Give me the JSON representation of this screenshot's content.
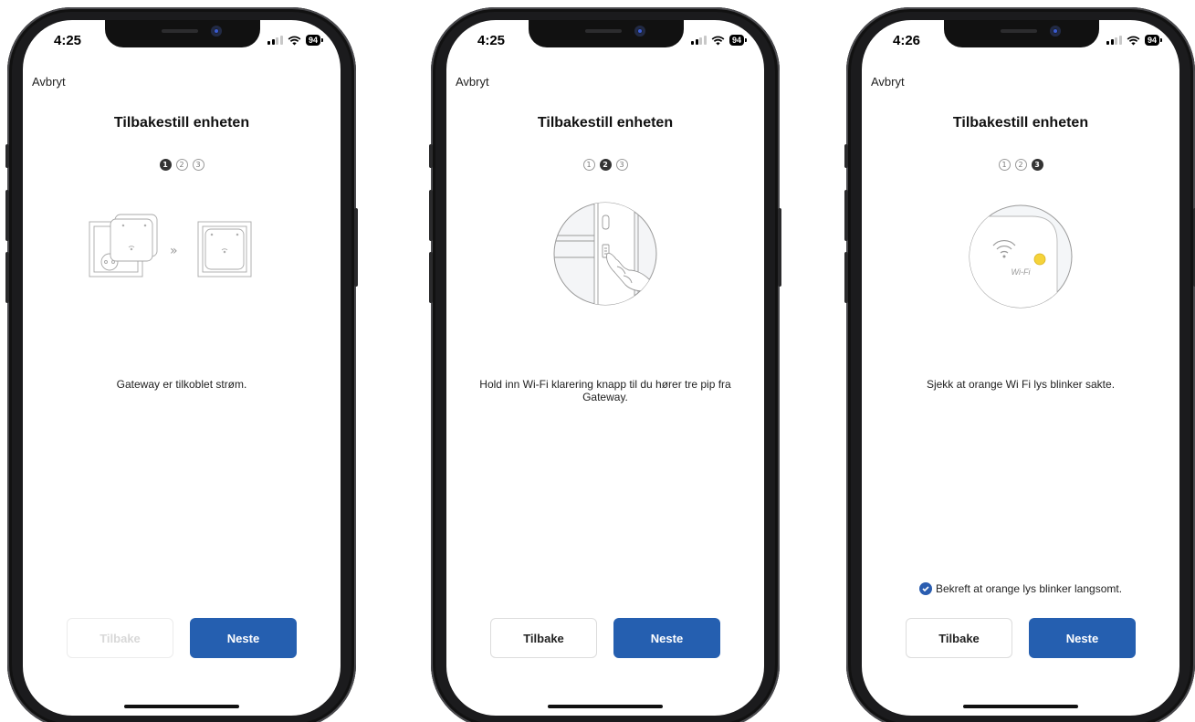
{
  "colors": {
    "accent": "#255fb0",
    "indicator_yellow": "#f5d33a"
  },
  "screens": [
    {
      "time": "4:25",
      "battery": "94",
      "cancel_label": "Avbryt",
      "title": "Tilbakestill enheten",
      "steps": [
        "1",
        "2",
        "3"
      ],
      "active_step": 1,
      "illustration": "gateway-plugged-into-socket",
      "description": "Gateway er tilkoblet strøm.",
      "back_label": "Tilbake",
      "back_disabled": true,
      "next_label": "Neste"
    },
    {
      "time": "4:25",
      "battery": "94",
      "cancel_label": "Avbryt",
      "title": "Tilbakestill enheten",
      "steps": [
        "1",
        "2",
        "3"
      ],
      "active_step": 2,
      "illustration": "finger-pressing-wifi-button",
      "description": "Hold inn Wi-Fi klarering knapp til du hører tre pip fra Gateway.",
      "back_label": "Tilbake",
      "back_disabled": false,
      "next_label": "Neste"
    },
    {
      "time": "4:26",
      "battery": "94",
      "cancel_label": "Avbryt",
      "title": "Tilbakestill enheten",
      "steps": [
        "1",
        "2",
        "3"
      ],
      "active_step": 3,
      "illustration": "wifi-led-blinking",
      "wifi_label": "Wi-Fi",
      "description": "Sjekk at orange Wi Fi lys blinker sakte.",
      "confirm_label": "Bekreft at orange lys blinker langsomt.",
      "confirm_checked": true,
      "back_label": "Tilbake",
      "back_disabled": false,
      "next_label": "Neste"
    }
  ]
}
